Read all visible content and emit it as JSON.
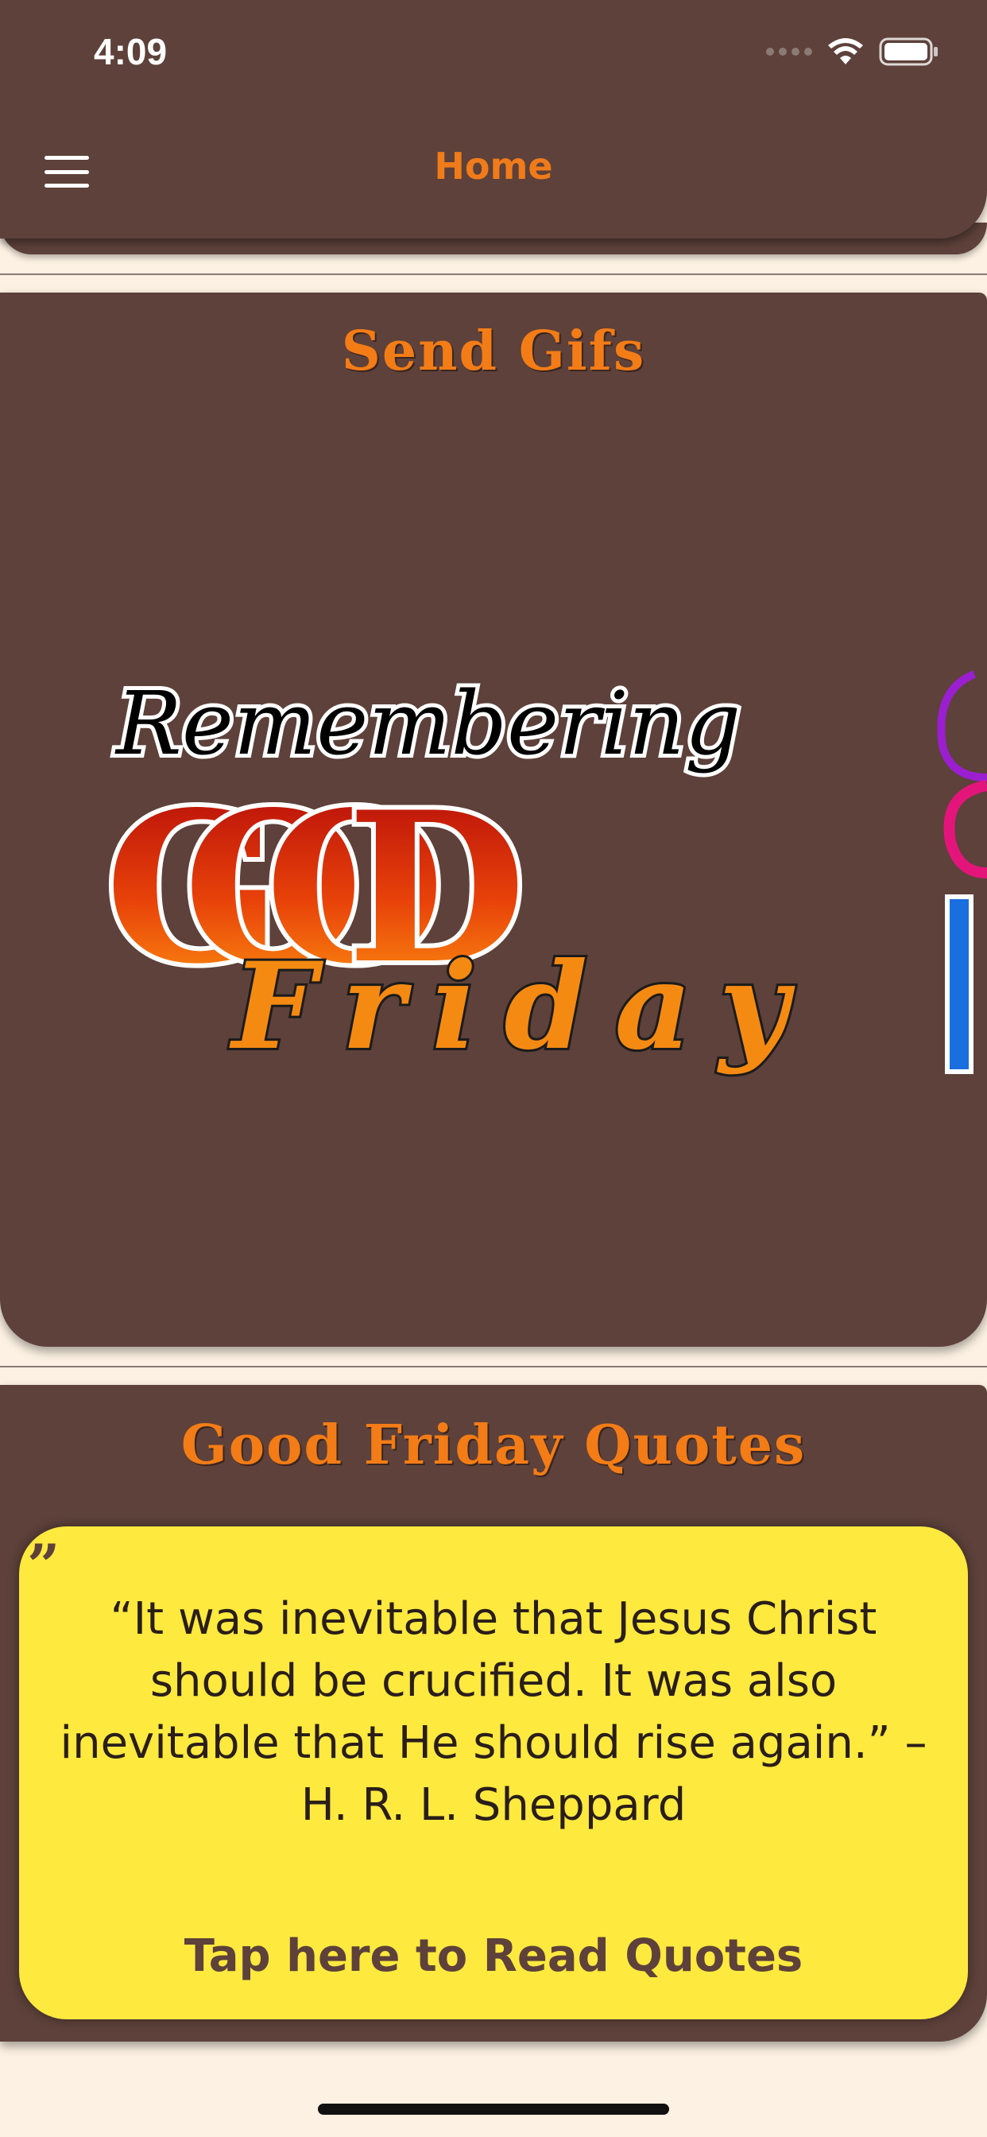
{
  "status_bar": {
    "time": "4:09",
    "icons": [
      "signal-icon",
      "wifi-icon",
      "battery-icon"
    ]
  },
  "header": {
    "title": "Home",
    "menu_icon": "hamburger-menu-icon"
  },
  "gifs_section": {
    "title": "Send Gifs",
    "items": [
      {
        "name": "remembering-good-friday-gif",
        "lines": [
          "Remembering",
          "GOOD",
          "Friday"
        ]
      }
    ]
  },
  "quotes_section": {
    "title": "Good Friday Quotes",
    "quote_mark": "”",
    "quote": "“It was inevitable that Jesus Christ should be crucified. It was also inevitable that He should rise again.” – H. R. L. Sheppard",
    "cta": "Tap here to Read Quotes"
  },
  "colors": {
    "brown": "#5d413a",
    "orange": "#f37c16",
    "yellow": "#fee93f",
    "cream": "#fcf1e2"
  }
}
